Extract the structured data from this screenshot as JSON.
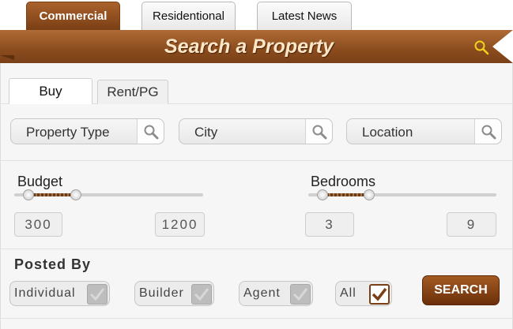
{
  "top_tabs": {
    "commercial": "Commercial",
    "residential": "Residentional",
    "news": "Latest News"
  },
  "ribbon": {
    "title": "Search a Property",
    "icon": "search-icon"
  },
  "sub_tabs": {
    "buy": "Buy",
    "rent": "Rent/PG"
  },
  "search_boxes": {
    "property_type": "Property Type",
    "city": "City",
    "location": "Location"
  },
  "budget": {
    "label": "Budget",
    "min": "300",
    "max": "1200"
  },
  "bedrooms": {
    "label": "Bedrooms",
    "min": "3",
    "max": "9"
  },
  "posted_by": {
    "label": "Posted By",
    "options": [
      {
        "label": "Individual",
        "checked": false
      },
      {
        "label": "Builder",
        "checked": false
      },
      {
        "label": "Agent",
        "checked": false
      },
      {
        "label": "All",
        "checked": true
      }
    ]
  },
  "search_button": "SEARCH",
  "colors": {
    "accent": "#8a4c1d",
    "accent_dark": "#6a2f0a",
    "ribbon_text": "#fbe6c8"
  }
}
